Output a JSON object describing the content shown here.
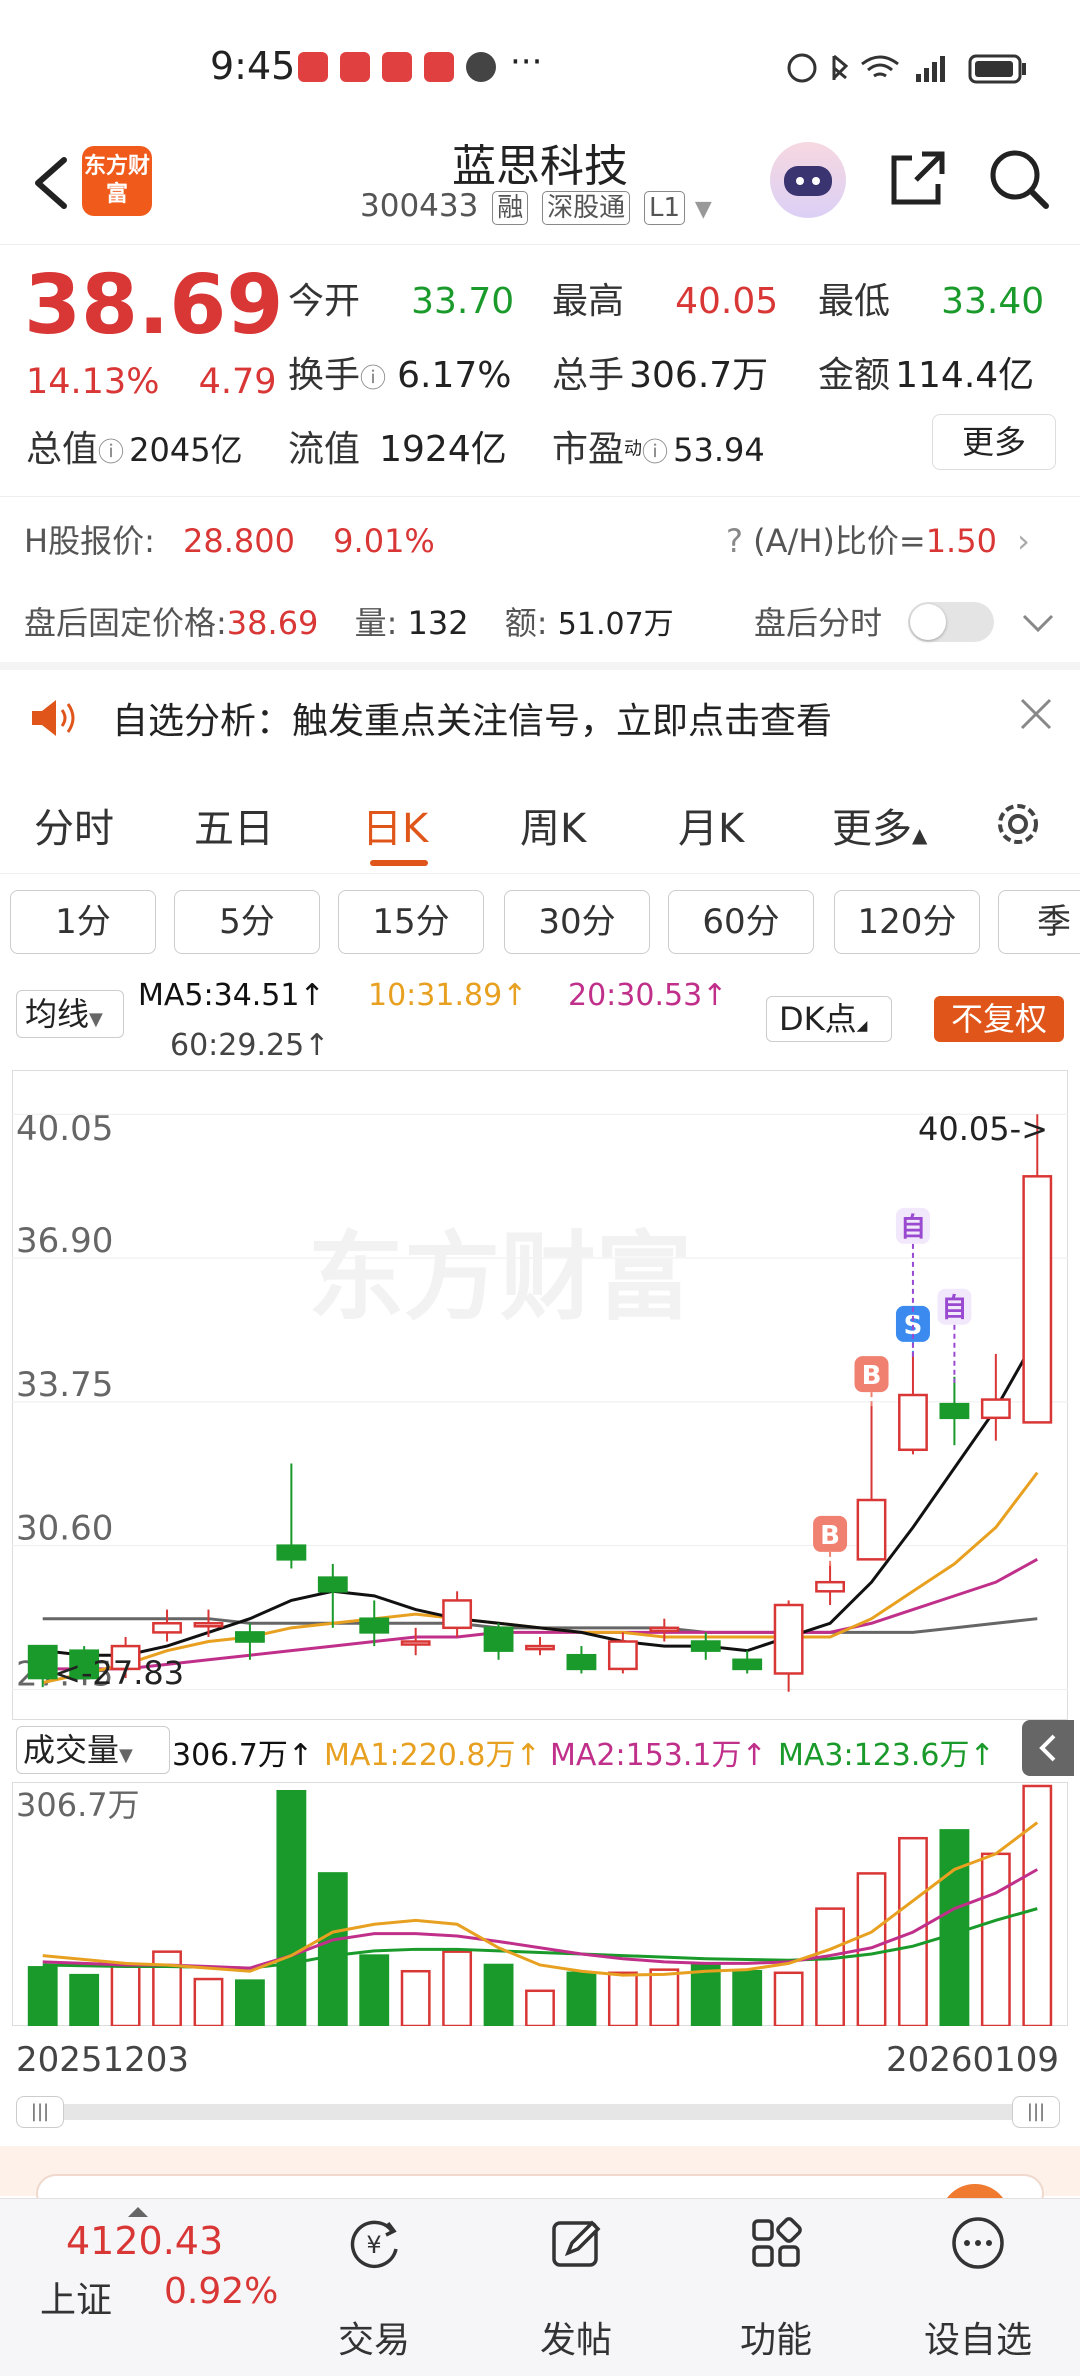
{
  "status_bar": {
    "time": "9:45",
    "icons": [
      "alarm-icon",
      "bluetooth-icon",
      "wifi-icon",
      "4g-signal-icon",
      "battery-icon"
    ],
    "dots": "···"
  },
  "header": {
    "app_logo": "东方财富",
    "title": "蓝思科技",
    "code": "300433",
    "tags": [
      "融",
      "深股通",
      "L1"
    ]
  },
  "quote": {
    "price": "38.69",
    "change_pct": "14.13%",
    "change_abs": "4.79",
    "open_label": "今开",
    "open": "33.70",
    "high_label": "最高",
    "high": "40.05",
    "low_label": "最低",
    "low": "33.40",
    "turnover_label": "换手",
    "turnover": "6.17%",
    "volume_label": "总手",
    "volume": "306.7万",
    "amount_label": "金额",
    "amount": "114.4亿",
    "mktcap_label": "总值",
    "mktcap": "2045亿",
    "float_label": "流值",
    "float": "1924亿",
    "pe_label": "市盈",
    "pe_sup": "动",
    "pe": "53.94",
    "more_label": "更多"
  },
  "h_share": {
    "label": "H股报价:",
    "price": "28.800",
    "pct": "9.01%",
    "ratio_label": "(A/H)比价=",
    "ratio": "1.50"
  },
  "after_hours": {
    "label": "盘后固定价格:",
    "price": "38.69",
    "vol_label": "量:",
    "vol": "132",
    "amt_label": "额:",
    "amt": "51.07万",
    "timeline_label": "盘后分时"
  },
  "alert": {
    "text": "自选分析：触发重点关注信号，立即点击查看"
  },
  "tabs": [
    "分时",
    "五日",
    "日K",
    "周K",
    "月K",
    "更多"
  ],
  "active_tab": 2,
  "periods": [
    "1分",
    "5分",
    "15分",
    "30分",
    "60分",
    "120分",
    "季"
  ],
  "ma_bar": {
    "selector": "均线",
    "ma5": "MA5:34.51↑",
    "ma10": "10:31.89↑",
    "ma20": "20:30.53↑",
    "ma60": "60:29.25↑",
    "dk": "DK点",
    "fuquan": "不复权"
  },
  "volume_bar": {
    "selector": "成交量",
    "vol": "306.7万↑",
    "ma1": "MA1:220.8万↑",
    "ma2": "MA2:153.1万↑",
    "ma3": "MA3:123.6万↑"
  },
  "chart_data": {
    "type": "candlestick",
    "title": "",
    "x_start": "20251203",
    "x_end": "20260109",
    "y_ticks": [
      "40.05",
      "36.90",
      "33.75",
      "30.60",
      "27.45"
    ],
    "ylim": [
      27.0,
      40.8
    ],
    "high_marker": "40.05->",
    "low_marker": "<-27.83",
    "watermark": "东方财富",
    "colors": {
      "up": "#d93636",
      "down": "#1a9a2a",
      "ma5": "#111111",
      "ma10": "#e8a020",
      "ma20": "#c0308a",
      "ma60": "#666666"
    },
    "candles": [
      {
        "o": 28.4,
        "c": 27.7,
        "h": 28.4,
        "l": 27.5
      },
      {
        "o": 28.3,
        "c": 27.7,
        "h": 28.4,
        "l": 27.83
      },
      {
        "o": 27.9,
        "c": 28.4,
        "h": 28.6,
        "l": 27.7
      },
      {
        "o": 28.7,
        "c": 28.9,
        "h": 29.2,
        "l": 28.5
      },
      {
        "o": 28.9,
        "c": 28.9,
        "h": 29.2,
        "l": 28.6
      },
      {
        "o": 28.7,
        "c": 28.5,
        "h": 28.9,
        "l": 28.1
      },
      {
        "o": 30.6,
        "c": 30.3,
        "h": 32.4,
        "l": 30.1
      },
      {
        "o": 29.9,
        "c": 29.6,
        "h": 30.2,
        "l": 28.8
      },
      {
        "o": 29.0,
        "c": 28.7,
        "h": 29.4,
        "l": 28.4
      },
      {
        "o": 28.5,
        "c": 28.5,
        "h": 28.8,
        "l": 28.2
      },
      {
        "o": 28.8,
        "c": 29.4,
        "h": 29.6,
        "l": 28.6
      },
      {
        "o": 28.8,
        "c": 28.3,
        "h": 28.9,
        "l": 28.1
      },
      {
        "o": 28.4,
        "c": 28.4,
        "h": 28.6,
        "l": 28.2
      },
      {
        "o": 28.2,
        "c": 27.9,
        "h": 28.4,
        "l": 27.8
      },
      {
        "o": 27.9,
        "c": 28.5,
        "h": 28.7,
        "l": 27.8
      },
      {
        "o": 28.8,
        "c": 28.8,
        "h": 29.0,
        "l": 28.5
      },
      {
        "o": 28.5,
        "c": 28.3,
        "h": 28.7,
        "l": 28.1
      },
      {
        "o": 28.1,
        "c": 27.9,
        "h": 28.3,
        "l": 27.8
      },
      {
        "o": 27.8,
        "c": 29.3,
        "h": 29.4,
        "l": 27.4
      },
      {
        "o": 29.6,
        "c": 29.8,
        "h": 30.2,
        "l": 29.3
      },
      {
        "o": 30.3,
        "c": 31.6,
        "h": 33.7,
        "l": 30.3
      },
      {
        "o": 32.7,
        "c": 33.9,
        "h": 34.8,
        "l": 32.6
      },
      {
        "o": 33.7,
        "c": 33.4,
        "h": 34.3,
        "l": 32.8
      },
      {
        "o": 33.4,
        "c": 33.8,
        "h": 34.8,
        "l": 32.9
      },
      {
        "o": 33.3,
        "c": 38.69,
        "h": 40.05,
        "l": 33.4
      }
    ],
    "signals": [
      {
        "i": 19,
        "label": "B"
      },
      {
        "i": 20,
        "label": "B"
      },
      {
        "i": 21,
        "label": "S"
      },
      {
        "i": 21,
        "label": "自"
      },
      {
        "i": 22,
        "label": "自"
      }
    ],
    "ma5": [
      28.3,
      28.2,
      28.2,
      28.4,
      28.7,
      29.0,
      29.4,
      29.6,
      29.5,
      29.2,
      29.0,
      28.9,
      28.8,
      28.7,
      28.5,
      28.4,
      28.4,
      28.3,
      28.6,
      28.9,
      29.8,
      31.0,
      32.3,
      33.6,
      35.2
    ],
    "ma10": [
      27.6,
      27.8,
      28.0,
      28.3,
      28.5,
      28.6,
      28.8,
      28.9,
      29.0,
      29.1,
      29.0,
      28.9,
      28.8,
      28.7,
      28.7,
      28.6,
      28.6,
      28.6,
      28.6,
      28.6,
      29.0,
      29.6,
      30.2,
      31.0,
      32.2
    ],
    "ma20": [
      27.9,
      27.9,
      27.9,
      28.0,
      28.1,
      28.2,
      28.3,
      28.4,
      28.5,
      28.6,
      28.6,
      28.7,
      28.7,
      28.7,
      28.7,
      28.7,
      28.7,
      28.7,
      28.7,
      28.7,
      28.9,
      29.2,
      29.5,
      29.8,
      30.3
    ],
    "ma60": [
      29.0,
      29.0,
      29.0,
      29.0,
      29.0,
      28.9,
      28.9,
      28.9,
      28.9,
      28.9,
      28.9,
      28.8,
      28.8,
      28.8,
      28.8,
      28.8,
      28.7,
      28.7,
      28.7,
      28.7,
      28.7,
      28.7,
      28.8,
      28.9,
      29.0
    ],
    "volume_max_label": "306.7万",
    "volumes": [
      75,
      65,
      78,
      95,
      60,
      58,
      300,
      195,
      90,
      70,
      95,
      78,
      45,
      68,
      68,
      72,
      80,
      70,
      68,
      150,
      195,
      240,
      250,
      220,
      306.7
    ],
    "vol_ma1": [
      90,
      85,
      80,
      78,
      74,
      70,
      90,
      120,
      130,
      135,
      130,
      100,
      78,
      70,
      65,
      66,
      70,
      72,
      80,
      98,
      120,
      160,
      200,
      220,
      260
    ],
    "vol_ma2": [
      82,
      80,
      78,
      78,
      76,
      74,
      90,
      110,
      118,
      118,
      115,
      108,
      100,
      92,
      86,
      82,
      80,
      80,
      82,
      90,
      100,
      120,
      150,
      170,
      200
    ],
    "vol_ma3": [
      78,
      77,
      76,
      76,
      75,
      74,
      80,
      90,
      96,
      98,
      98,
      96,
      94,
      92,
      90,
      88,
      86,
      85,
      84,
      86,
      92,
      102,
      118,
      135,
      150
    ]
  },
  "bottom_nav": {
    "index_value": "4120.43",
    "index_name": "上证",
    "index_pct": "0.92%",
    "items": [
      "交易",
      "发帖",
      "功能",
      "设自选"
    ]
  }
}
